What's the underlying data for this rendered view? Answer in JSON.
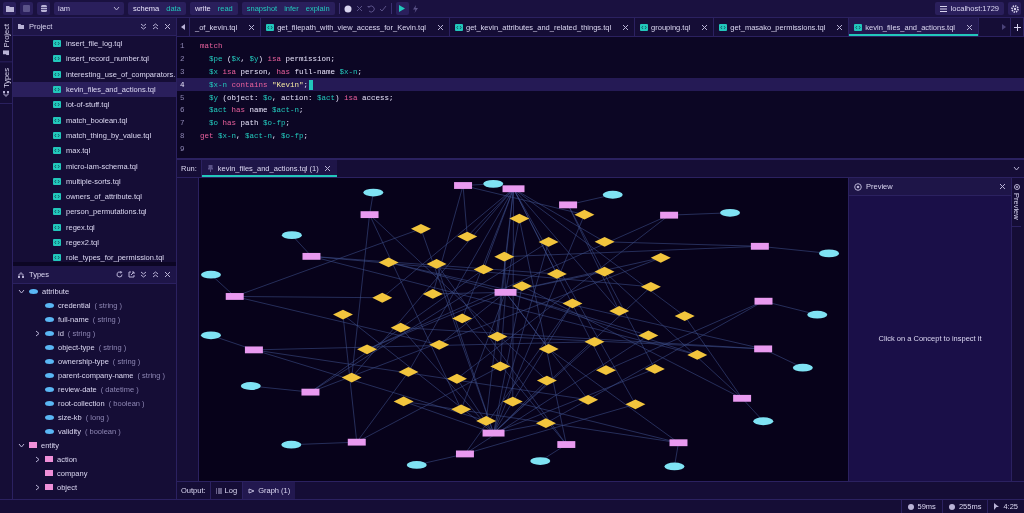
{
  "toolbar": {
    "database": "iam",
    "groups": [
      [
        {
          "label": "schema",
          "selected": false
        },
        {
          "label": "data",
          "selected": true
        }
      ],
      [
        {
          "label": "write",
          "selected": false
        },
        {
          "label": "read",
          "selected": true
        }
      ],
      [
        {
          "label": "snapshot",
          "selected": true
        },
        {
          "label": "infer",
          "selected": true
        },
        {
          "label": "explain",
          "selected": true
        }
      ]
    ],
    "server": "localhost:1729"
  },
  "side_rail": [
    {
      "label": "Project",
      "kind": "project"
    },
    {
      "label": "Types",
      "kind": "types"
    }
  ],
  "project": {
    "title": "Project",
    "files": [
      {
        "name": "insert_file_log.tql",
        "selected": false
      },
      {
        "name": "insert_record_number.tql",
        "selected": false
      },
      {
        "name": "interesting_use_of_comparators.",
        "selected": false
      },
      {
        "name": "kevin_files_and_actions.tql",
        "selected": true
      },
      {
        "name": "lot-of-stuff.tql",
        "selected": false
      },
      {
        "name": "match_boolean.tql",
        "selected": false
      },
      {
        "name": "match_thing_by_value.tql",
        "selected": false
      },
      {
        "name": "max.tql",
        "selected": false
      },
      {
        "name": "micro-iam-schema.tql",
        "selected": false
      },
      {
        "name": "multiple-sorts.tql",
        "selected": false
      },
      {
        "name": "owners_of_attribute.tql",
        "selected": false
      },
      {
        "name": "person_permutations.tql",
        "selected": false
      },
      {
        "name": "regex.tql",
        "selected": false
      },
      {
        "name": "regex2.tql",
        "selected": false
      },
      {
        "name": "role_types_for_permission.tql",
        "selected": false
      }
    ]
  },
  "types": {
    "title": "Types",
    "tree": [
      {
        "name": "attribute",
        "kind": "attribute",
        "expanded": true,
        "children": [
          {
            "name": "credential",
            "value_type": "( string )",
            "kind": "attribute"
          },
          {
            "name": "full-name",
            "value_type": "( string )",
            "kind": "attribute"
          },
          {
            "name": "id",
            "value_type": "( string )",
            "kind": "attribute",
            "expanded": false
          },
          {
            "name": "object-type",
            "value_type": "( string )",
            "kind": "attribute"
          },
          {
            "name": "ownership-type",
            "value_type": "( string )",
            "kind": "attribute"
          },
          {
            "name": "parent-company-name",
            "value_type": "( string )",
            "kind": "attribute"
          },
          {
            "name": "review-date",
            "value_type": "( datetime )",
            "kind": "attribute"
          },
          {
            "name": "root-collection",
            "value_type": "( boolean )",
            "kind": "attribute"
          },
          {
            "name": "size-kb",
            "value_type": "( long )",
            "kind": "attribute"
          },
          {
            "name": "validity",
            "value_type": "( boolean )",
            "kind": "attribute"
          }
        ]
      },
      {
        "name": "entity",
        "kind": "entity",
        "expanded": true,
        "children": [
          {
            "name": "action",
            "kind": "entity",
            "expanded": false
          },
          {
            "name": "company",
            "kind": "entity"
          },
          {
            "name": "object",
            "kind": "entity",
            "expanded": false
          }
        ]
      }
    ]
  },
  "editor_tabs": [
    {
      "label": "_of_kevin.tql",
      "icon": false,
      "selected": false
    },
    {
      "label": "get_filepath_with_view_access_for_Kevin.tql",
      "icon": true,
      "selected": false
    },
    {
      "label": "get_kevin_attributes_and_related_things.tql",
      "icon": true,
      "selected": false
    },
    {
      "label": "grouping.tql",
      "icon": true,
      "selected": false
    },
    {
      "label": "get_masako_permissions.tql",
      "icon": true,
      "selected": false
    },
    {
      "label": "kevin_files_and_actions.tql",
      "icon": true,
      "selected": true
    }
  ],
  "code": [
    {
      "number": "1",
      "selected": false,
      "tokens": [
        {
          "text": "match",
          "kind": "keyword"
        }
      ]
    },
    {
      "number": "2",
      "selected": false,
      "tokens": [
        {
          "text": "  $pe",
          "kind": "variable"
        },
        {
          "text": " (",
          "kind": "plain"
        },
        {
          "text": "$x",
          "kind": "variable"
        },
        {
          "text": ", ",
          "kind": "plain"
        },
        {
          "text": "$y",
          "kind": "variable"
        },
        {
          "text": ") ",
          "kind": "plain"
        },
        {
          "text": "isa",
          "kind": "keyword"
        },
        {
          "text": " permission;",
          "kind": "plain"
        }
      ]
    },
    {
      "number": "3",
      "selected": false,
      "tokens": [
        {
          "text": "  $x",
          "kind": "variable"
        },
        {
          "text": " isa",
          "kind": "keyword"
        },
        {
          "text": " person, ",
          "kind": "plain"
        },
        {
          "text": "has",
          "kind": "keyword"
        },
        {
          "text": " full-name ",
          "kind": "plain"
        },
        {
          "text": "$x-n",
          "kind": "variable"
        },
        {
          "text": ";",
          "kind": "plain"
        }
      ]
    },
    {
      "number": "4",
      "selected": true,
      "tokens": [
        {
          "text": "  $x-n",
          "kind": "variable"
        },
        {
          "text": " contains ",
          "kind": "keyword"
        },
        {
          "text": "\"Kevin\"",
          "kind": "string"
        },
        {
          "text": ";",
          "kind": "plain"
        }
      ]
    },
    {
      "number": "5",
      "selected": false,
      "tokens": [
        {
          "text": "  $y",
          "kind": "variable"
        },
        {
          "text": " (object: ",
          "kind": "plain"
        },
        {
          "text": "$o",
          "kind": "variable"
        },
        {
          "text": ", action: ",
          "kind": "plain"
        },
        {
          "text": "$act",
          "kind": "variable"
        },
        {
          "text": ") ",
          "kind": "plain"
        },
        {
          "text": "isa",
          "kind": "keyword"
        },
        {
          "text": " access;",
          "kind": "plain"
        }
      ]
    },
    {
      "number": "6",
      "selected": false,
      "tokens": [
        {
          "text": "  $act",
          "kind": "variable"
        },
        {
          "text": " has",
          "kind": "keyword"
        },
        {
          "text": " name ",
          "kind": "plain"
        },
        {
          "text": "$act-n",
          "kind": "variable"
        },
        {
          "text": ";",
          "kind": "plain"
        }
      ]
    },
    {
      "number": "7",
      "selected": false,
      "tokens": [
        {
          "text": "  $o",
          "kind": "variable"
        },
        {
          "text": " has",
          "kind": "keyword"
        },
        {
          "text": " path ",
          "kind": "plain"
        },
        {
          "text": "$o-fp",
          "kind": "variable"
        },
        {
          "text": ";",
          "kind": "plain"
        }
      ]
    },
    {
      "number": "8",
      "selected": false,
      "tokens": [
        {
          "text": "get",
          "kind": "keyword"
        },
        {
          "text": " $x-n",
          "kind": "variable"
        },
        {
          "text": ", ",
          "kind": "plain"
        },
        {
          "text": "$act-n",
          "kind": "variable"
        },
        {
          "text": ", ",
          "kind": "plain"
        },
        {
          "text": "$o-fp",
          "kind": "variable"
        },
        {
          "text": ";",
          "kind": "plain"
        }
      ]
    },
    {
      "number": "9",
      "selected": false
    }
  ],
  "run": {
    "label": "Run:",
    "tabs": [
      {
        "label": "kevin_files_and_actions.tql (1)",
        "selected": true
      }
    ]
  },
  "preview": {
    "title": "Preview",
    "message": "Click on a Concept to inspect it",
    "rail_label": "Preview"
  },
  "output": {
    "label": "Output:",
    "tabs": [
      {
        "label": "Log",
        "kind": "log",
        "selected": false
      },
      {
        "label": "Graph (1)",
        "kind": "graph",
        "selected": true
      }
    ]
  },
  "status_bar": [
    {
      "text": "59ms",
      "kind": "query"
    },
    {
      "text": "255ms",
      "kind": "total"
    },
    {
      "text": "4:25",
      "kind": "cursor"
    }
  ]
}
